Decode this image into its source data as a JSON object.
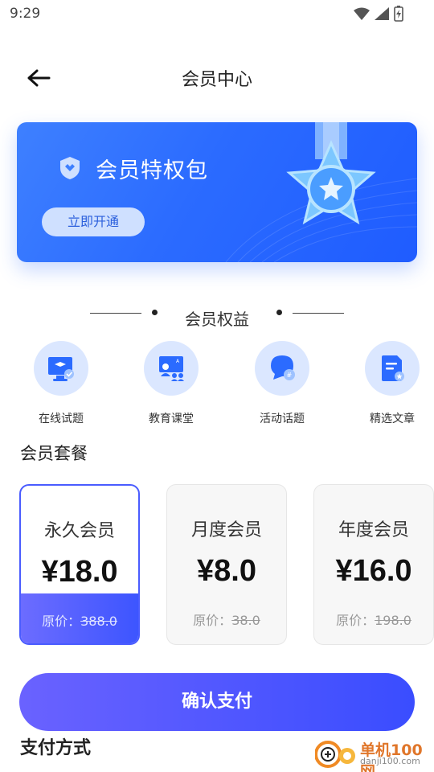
{
  "status_bar": {
    "time": "9:29"
  },
  "header": {
    "title": "会员中心"
  },
  "banner": {
    "title": "会员特权包",
    "button_label": "立即开通"
  },
  "benefits_section": {
    "title": "会员权益",
    "items": [
      {
        "label": "在线试题",
        "icon": "online-exam-icon"
      },
      {
        "label": "教育课堂",
        "icon": "classroom-icon"
      },
      {
        "label": "活动话题",
        "icon": "topic-chat-icon"
      },
      {
        "label": "精选文章",
        "icon": "article-icon"
      }
    ]
  },
  "plans_section": {
    "title": "会员套餐",
    "plans": [
      {
        "name": "永久会员",
        "price": "¥18.0",
        "original_label": "原价：",
        "original_price": "388.0",
        "selected": true
      },
      {
        "name": "月度会员",
        "price": "¥8.0",
        "original_label": "原价：",
        "original_price": "38.0",
        "selected": false
      },
      {
        "name": "年度会员",
        "price": "¥16.0",
        "original_label": "原价：",
        "original_price": "198.0",
        "selected": false
      }
    ]
  },
  "pay_button": {
    "label": "确认支付"
  },
  "payment_method": {
    "title": "支付方式"
  },
  "watermark": {
    "text": "单机100网",
    "sub": "danji100.com"
  },
  "colors": {
    "accent": "#2b6bff",
    "button_gradient_start": "#6a62ff",
    "button_gradient_end": "#3a4dff",
    "icon_bg": "#dbe7ff"
  }
}
